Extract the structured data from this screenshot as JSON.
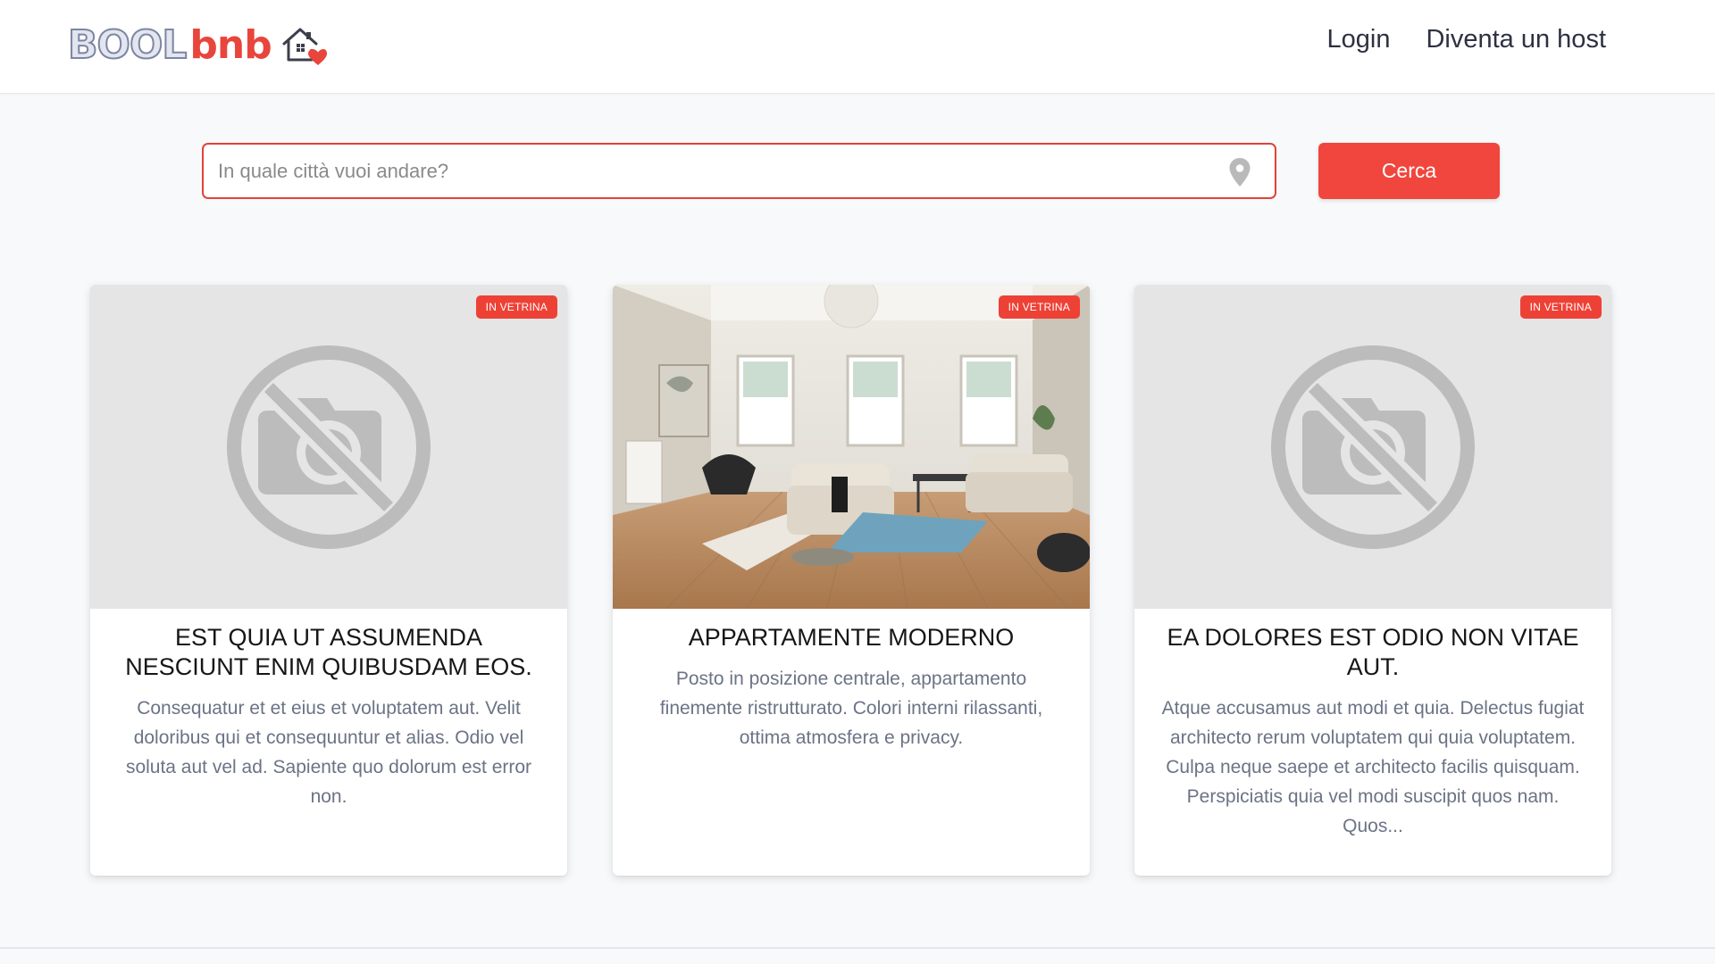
{
  "header": {
    "logo": {
      "part1": "BOOL",
      "part2": "bnb",
      "icon": "house-heart-icon"
    },
    "nav": [
      {
        "label": "Login"
      },
      {
        "label": "Diventa un host"
      }
    ]
  },
  "search": {
    "placeholder": "In quale città vuoi andare?",
    "value": "",
    "icon": "map-pin-icon",
    "button_label": "Cerca"
  },
  "colors": {
    "accent": "#f1463d",
    "badge": "#ee4136",
    "text_secondary": "#6b7385"
  },
  "cards": [
    {
      "badge": "IN VETRINA",
      "image": "no-photo-icon",
      "title": "Est quia ut assumenda nesciunt enim quibusdam eos.",
      "description": "Consequatur et et eius et voluptatem aut. Velit doloribus qui et consequuntur et alias. Odio vel soluta aut vel ad. Sapiente quo dolorum est error non."
    },
    {
      "badge": "IN VETRINA",
      "image": "living-room-photo",
      "title": "Appartamente moderno",
      "description": "Posto in posizione centrale, appartamento finemente ristrutturato. Colori interni rilassanti, ottima atmosfera e privacy."
    },
    {
      "badge": "IN VETRINA",
      "image": "no-photo-icon",
      "title": "Ea dolores est odio non vitae aut.",
      "description": "Atque accusamus aut modi et quia. Delectus fugiat architecto rerum voluptatem qui quia voluptatem. Culpa neque saepe et architecto facilis quisquam. Perspiciatis quia vel modi suscipit quos nam. Quos..."
    }
  ]
}
